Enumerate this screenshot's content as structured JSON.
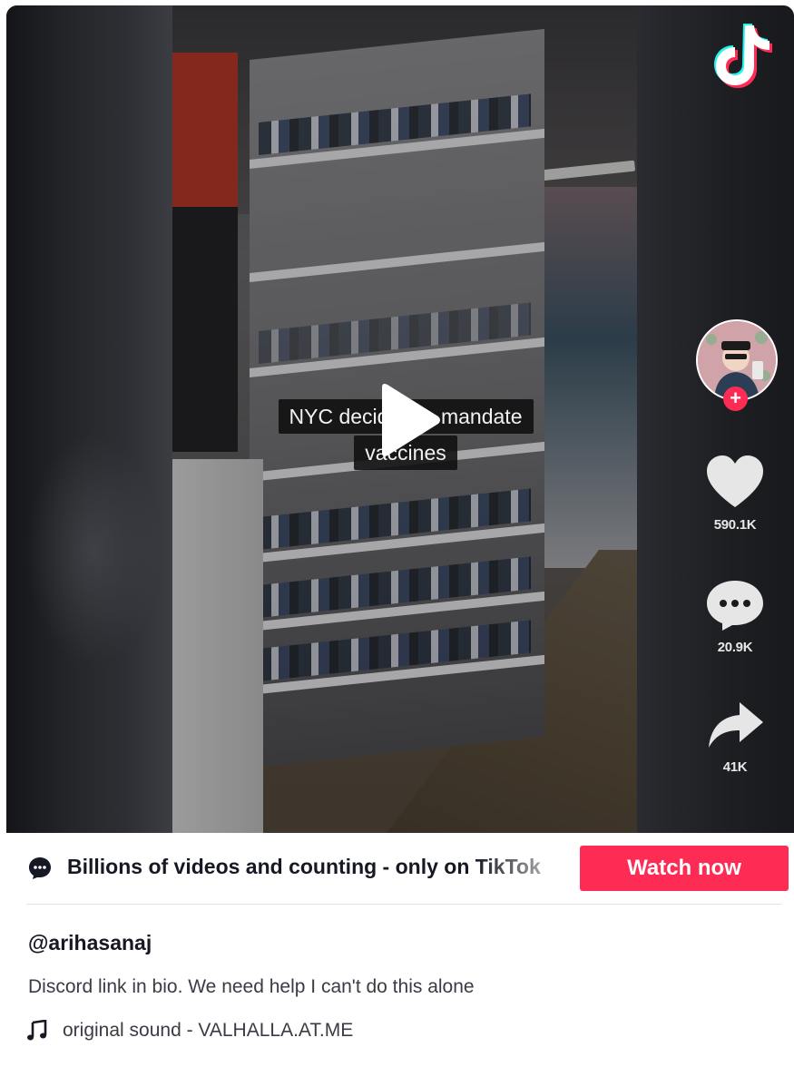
{
  "video": {
    "caption_line1": "NYC decided to mandate",
    "caption_line2": "vaccines",
    "play_icon": "play-icon",
    "logo_icon": "tiktok-logo-icon"
  },
  "actions": {
    "avatar_icon": "user-avatar",
    "follow_label": "+",
    "likes": "590.1K",
    "comments": "20.9K",
    "shares": "41K",
    "like_icon": "heart-icon",
    "comment_icon": "comment-bubble-icon",
    "share_icon": "share-arrow-icon"
  },
  "promo": {
    "text": "Billions of videos and counting - only on TikTok",
    "button_label": "Watch now",
    "icon": "chat-bubble-icon"
  },
  "post": {
    "username": "@arihasanaj",
    "description": "Discord link in bio. We need help I can't do this alone",
    "sound": "original sound - VALHALLA.AT.ME",
    "sound_icon": "music-note-icon"
  },
  "colors": {
    "accent": "#fe2c55",
    "text_primary": "#161823",
    "text_secondary": "#3a3b44"
  }
}
